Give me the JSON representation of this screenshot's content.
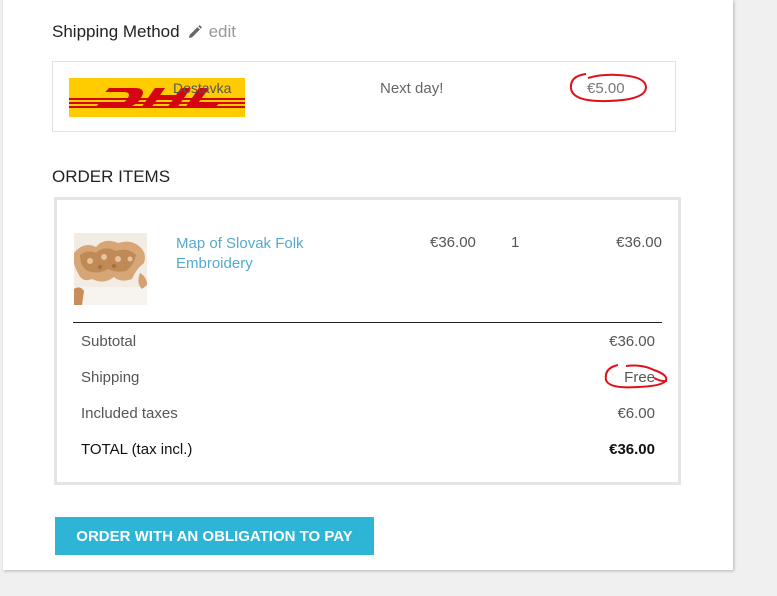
{
  "colors": {
    "accent": "#2eb5d5",
    "link": "#56aacd",
    "annotation": "#e0101a",
    "dhl_yellow": "#ffcc00",
    "dhl_red": "#d40511"
  },
  "shipping": {
    "title": "Shipping Method",
    "edit_icon": "pencil-icon",
    "edit_label": "edit",
    "carrier": {
      "logo": "DHL",
      "name": "Dostavka",
      "delay": "Next day!",
      "price": "€5.00"
    }
  },
  "order_items": {
    "title": "ORDER ITEMS",
    "items": [
      {
        "name": "Map of Slovak Folk Embroidery",
        "unit_price": "€36.00",
        "quantity": "1",
        "total": "€36.00"
      }
    ],
    "summary": {
      "subtotal_label": "Subtotal",
      "subtotal_value": "€36.00",
      "shipping_label": "Shipping",
      "shipping_value": "Free",
      "taxes_label": "Included taxes",
      "taxes_value": "€6.00",
      "total_label": "TOTAL (tax incl.)",
      "total_value": "€36.00"
    }
  },
  "actions": {
    "order_button": "ORDER WITH AN OBLIGATION TO PAY"
  }
}
